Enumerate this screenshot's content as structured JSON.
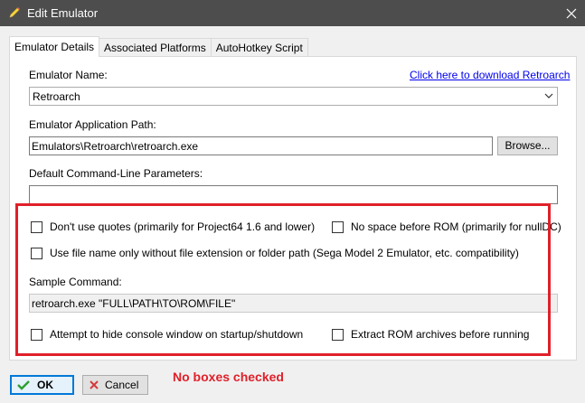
{
  "window": {
    "title": "Edit Emulator",
    "title_icon": "pencil-icon",
    "close_icon": "close-icon"
  },
  "tabs": [
    {
      "label": "Emulator Details",
      "active": true
    },
    {
      "label": "Associated Platforms",
      "active": false
    },
    {
      "label": "AutoHotkey Script",
      "active": false
    }
  ],
  "details": {
    "name_label": "Emulator Name:",
    "download_link": "Click here to download Retroarch",
    "name_value": "Retroarch",
    "path_label": "Emulator Application Path:",
    "path_value": "Emulators\\Retroarch\\retroarch.exe",
    "browse_label": "Browse...",
    "params_label": "Default Command-Line Parameters:",
    "params_value": "",
    "options": {
      "no_quotes": {
        "label": "Don't use quotes (primarily for Project64 1.6 and lower)",
        "checked": false
      },
      "no_space": {
        "label": "No space before ROM (primarily for nullDC)",
        "checked": false
      },
      "filename_only": {
        "label": "Use file name only without file extension or folder path (Sega Model 2 Emulator, etc. compatibility)",
        "checked": false
      },
      "hide_console": {
        "label": "Attempt to hide console window on startup/shutdown",
        "checked": false
      },
      "extract_rom": {
        "label": "Extract ROM archives before running",
        "checked": false
      }
    },
    "sample_label": "Sample Command:",
    "sample_value": "retroarch.exe \"FULL\\PATH\\TO\\ROM\\FILE\""
  },
  "footer": {
    "ok_label": "OK",
    "ok_icon": "checkmark-icon",
    "cancel_label": "Cancel",
    "cancel_icon": "x-icon"
  },
  "annotation": {
    "text": "No boxes checked",
    "color": "#e0202a"
  },
  "colors": {
    "titlebar": "#4d4d4d",
    "link": "#0000ee",
    "ok_accent": "#0078d7"
  }
}
